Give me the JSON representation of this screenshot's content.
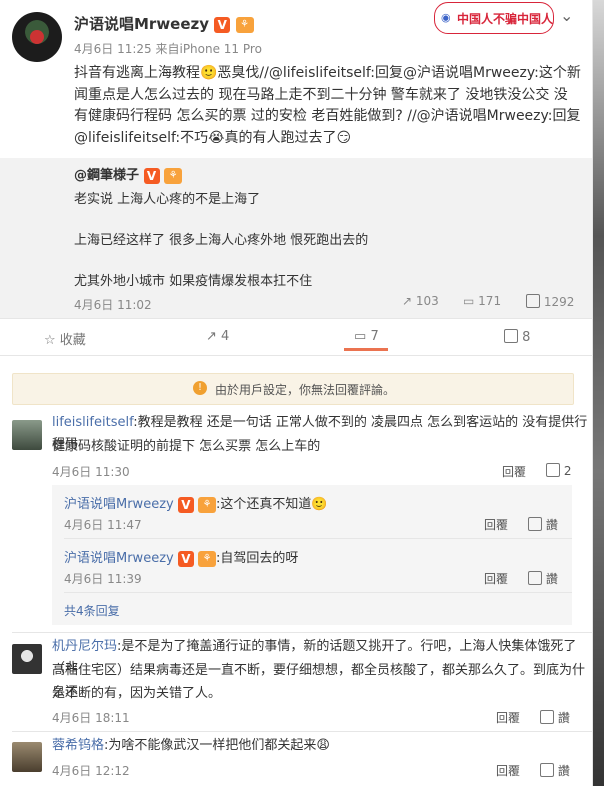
{
  "post": {
    "author": "沪语说唱Mrweezy",
    "meta": "4月6日 11:25 来自iPhone 11 Pro",
    "stamp_text": "中国人不骗中国人",
    "body_lines": [
      "抖音有逃离上海教程🙂恶臭伐//@lifeislifeitself:回复@沪语说唱Mrweezy:这个新",
      "闻重点是人怎么过去的 现在马路上走不到二十分钟 警车就来了 没地铁没公交 没",
      "有健康码行程码 怎么买的票 过的安检 老百姓能做到? //@沪语说唱Mrweezy:回复",
      "@lifeislifeitself:不巧😭真的有人跑过去了😏"
    ]
  },
  "quote": {
    "author": "@鋼筆様子",
    "lines": [
      "老实说 上海人心疼的不是上海了",
      "上海已经这样了 很多上海人心疼外地 恨死跑出去的",
      "尤其外地小城市 如果疫情爆发根本扛不住"
    ],
    "date": "4月6日 11:02",
    "repost": "103",
    "comment": "171",
    "like": "1292"
  },
  "toolbar": {
    "fav": "收藏",
    "repost": "4",
    "comment": "7",
    "like": "8"
  },
  "notice": "由於用戶設定，你無法回覆評論。",
  "comments": [
    {
      "name": "lifeislifeitself",
      "text1": ":教程是教程 还是一句话 正常人做不到的 凌晨四点 怎么到客运站的 没有提供行程码",
      "text2": "健康码核酸证明的前提下 怎么买票 怎么上车的",
      "date": "4月6日 11:30",
      "reply": "回覆",
      "likes": "2"
    },
    {
      "name": "机丹尼尔玛",
      "text1": ":是不是为了掩盖通行证的事情，新的话题又挑开了。行吧，上海人快集体饿死了（非",
      "text2": "高档住宅区）结果病毒还是一直不断，要仔细想想，都全员核酸了，都关那么久了。到底为什么还",
      "text3": "是不断的有，因为关错了人。",
      "date": "4月6日 18:11",
      "reply": "回覆",
      "likes": "讚"
    },
    {
      "name": "蓉希钨格",
      "text1": ":为啥不能像武汉一样把他们都关起来😩",
      "date": "4月6日 12:12",
      "reply": "回覆",
      "likes": "讚"
    }
  ],
  "replies": [
    {
      "name": "沪语说唱Mrweezy",
      "text": ":这个还真不知道🙂",
      "date": "4月6日 11:47",
      "reply": "回覆",
      "likes": "讚"
    },
    {
      "name": "沪语说唱Mrweezy",
      "text": ":自驾回去的呀",
      "date": "4月6日 11:39",
      "reply": "回覆",
      "likes": "讚"
    }
  ],
  "more_replies": "共4条回复"
}
